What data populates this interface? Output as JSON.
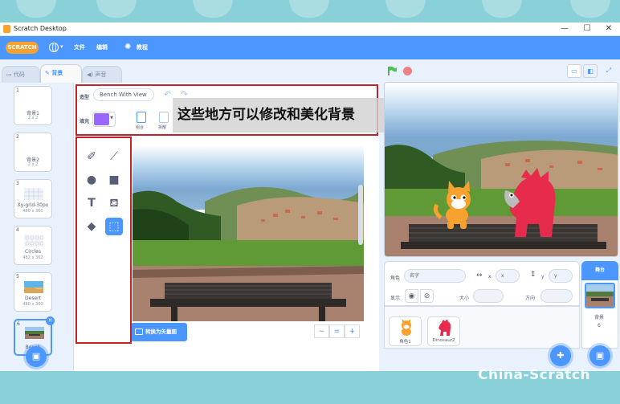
{
  "window": {
    "title": "Scratch Desktop",
    "minimize": "—",
    "maximize": "☐",
    "close": "✕"
  },
  "menu": {
    "logo": "SCRATCH",
    "file": "文件",
    "edit": "编辑",
    "tutorials": "教程"
  },
  "tabs": {
    "code": "代码",
    "backdrops": "背景",
    "sounds": "声音"
  },
  "backdrops": [
    {
      "num": "1",
      "name": "背景1",
      "size": "2 x 2"
    },
    {
      "num": "2",
      "name": "背景2",
      "size": "2 x 2"
    },
    {
      "num": "3",
      "name": "Xy-grid-30px",
      "size": "480 x 360"
    },
    {
      "num": "4",
      "name": "Circles",
      "size": "482 x 362"
    },
    {
      "num": "5",
      "name": "Desert",
      "size": "480 x 360"
    },
    {
      "num": "6",
      "name": "Bench"
    }
  ],
  "paint": {
    "name_label": "造型",
    "costume_name": "Bench With View",
    "fill_label": "填充",
    "fill_color": "#9966ff",
    "group_label": "组合",
    "ungroup_label": "拆散",
    "convert_button": "转换为矢量图",
    "zoom_out": "−",
    "zoom_reset": "=",
    "zoom_in": "+"
  },
  "annotation": "这些地方可以修改和美化背景",
  "sprite_info": {
    "sprite_label": "角色",
    "name_placeholder": "名字",
    "x_label": "x",
    "x_value": "x",
    "y_label": "y",
    "y_value": "y",
    "show_label": "显示",
    "size_label": "大小",
    "direction_label": "方向"
  },
  "sprites": [
    {
      "name": "角色1"
    },
    {
      "name": "Dinosaur2"
    }
  ],
  "stage_pane": {
    "title": "舞台",
    "backdrops_label": "背景",
    "backdrops_count": "6"
  },
  "watermark": "China-Scratch",
  "colors": {
    "scratch_blue": "#4c97ff",
    "annotation_box": "#c2222a",
    "scratch_orange": "#f7a12e"
  }
}
